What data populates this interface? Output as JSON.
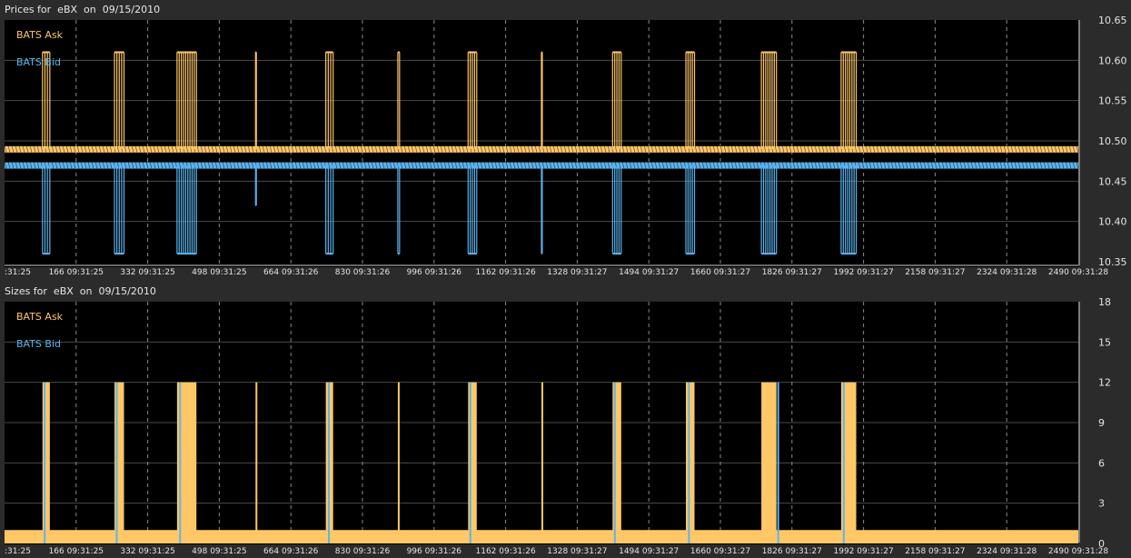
{
  "chart_data": [
    {
      "type": "line",
      "title": "Prices for  eBX  on  09/15/2010",
      "legend": "top-left",
      "grid": true,
      "ylim": [
        10.35,
        10.65
      ],
      "y_ticks": [
        "10.35",
        "10.40",
        "10.45",
        "10.50",
        "10.55",
        "10.60",
        "10.65"
      ],
      "x_range": [
        0,
        2490
      ],
      "x_ticks": [
        {
          "x": 0,
          "label": ":31:25"
        },
        {
          "x": 166,
          "label": "166 09:31:25"
        },
        {
          "x": 332,
          "label": "332 09:31:25"
        },
        {
          "x": 498,
          "label": "498 09:31:25"
        },
        {
          "x": 664,
          "label": "664 09:31:26"
        },
        {
          "x": 830,
          "label": "830 09:31:26"
        },
        {
          "x": 996,
          "label": "996 09:31:26"
        },
        {
          "x": 1162,
          "label": "1162 09:31:26"
        },
        {
          "x": 1328,
          "label": "1328 09:31:27"
        },
        {
          "x": 1494,
          "label": "1494 09:31:27"
        },
        {
          "x": 1660,
          "label": "1660 09:31:27"
        },
        {
          "x": 1826,
          "label": "1826 09:31:27"
        },
        {
          "x": 1992,
          "label": "1992 09:31:27"
        },
        {
          "x": 2158,
          "label": "2158 09:31:27"
        },
        {
          "x": 2324,
          "label": "2324 09:31:28"
        },
        {
          "x": 2490,
          "label": "2490 09:31:28"
        }
      ],
      "series": [
        {
          "name": "BATS Ask",
          "color": "#ffc766",
          "baseline": 10.49,
          "spikes": [
            {
              "x0": 88,
              "x1": 105,
              "y": 10.61
            },
            {
              "x0": 255,
              "x1": 277,
              "y": 10.61
            },
            {
              "x0": 400,
              "x1": 445,
              "y": 10.61
            },
            {
              "x0": 582,
              "x1": 584,
              "y": 10.61
            },
            {
              "x0": 745,
              "x1": 762,
              "y": 10.61
            },
            {
              "x0": 912,
              "x1": 916,
              "y": 10.61
            },
            {
              "x0": 1075,
              "x1": 1095,
              "y": 10.61
            },
            {
              "x0": 1245,
              "x1": 1247,
              "y": 10.61
            },
            {
              "x0": 1410,
              "x1": 1430,
              "y": 10.61
            },
            {
              "x0": 1580,
              "x1": 1600,
              "y": 10.61
            },
            {
              "x0": 1755,
              "x1": 1790,
              "y": 10.61
            },
            {
              "x0": 1940,
              "x1": 1975,
              "y": 10.61
            }
          ]
        },
        {
          "name": "BATS Bid",
          "color": "#5ab4f0",
          "baseline": 10.47,
          "spikes": [
            {
              "x0": 88,
              "x1": 105,
              "y": 10.36
            },
            {
              "x0": 255,
              "x1": 277,
              "y": 10.36
            },
            {
              "x0": 400,
              "x1": 445,
              "y": 10.36
            },
            {
              "x0": 582,
              "x1": 584,
              "y": 10.42
            },
            {
              "x0": 745,
              "x1": 762,
              "y": 10.36
            },
            {
              "x0": 912,
              "x1": 916,
              "y": 10.36
            },
            {
              "x0": 1075,
              "x1": 1095,
              "y": 10.36
            },
            {
              "x0": 1245,
              "x1": 1247,
              "y": 10.36
            },
            {
              "x0": 1410,
              "x1": 1430,
              "y": 10.36
            },
            {
              "x0": 1580,
              "x1": 1600,
              "y": 10.36
            },
            {
              "x0": 1755,
              "x1": 1790,
              "y": 10.36
            },
            {
              "x0": 1940,
              "x1": 1975,
              "y": 10.36
            }
          ]
        }
      ]
    },
    {
      "type": "bar",
      "title": "Sizes for  eBX  on  09/15/2010",
      "legend": "top-left",
      "grid": true,
      "ylim": [
        0,
        18
      ],
      "y_ticks": [
        "0",
        "3",
        "6",
        "9",
        "12",
        "15",
        "18"
      ],
      "x_range": [
        0,
        2490
      ],
      "x_ticks": [
        {
          "x": 0,
          "label": ":31:25"
        },
        {
          "x": 166,
          "label": "166 09:31:25"
        },
        {
          "x": 332,
          "label": "332 09:31:25"
        },
        {
          "x": 498,
          "label": "498 09:31:25"
        },
        {
          "x": 664,
          "label": "664 09:31:26"
        },
        {
          "x": 830,
          "label": "830 09:31:26"
        },
        {
          "x": 996,
          "label": "996 09:31:26"
        },
        {
          "x": 1162,
          "label": "1162 09:31:26"
        },
        {
          "x": 1328,
          "label": "1328 09:31:27"
        },
        {
          "x": 1494,
          "label": "1494 09:31:27"
        },
        {
          "x": 1660,
          "label": "1660 09:31:27"
        },
        {
          "x": 1826,
          "label": "1826 09:31:27"
        },
        {
          "x": 1992,
          "label": "1992 09:31:27"
        },
        {
          "x": 2158,
          "label": "2158 09:31:27"
        },
        {
          "x": 2324,
          "label": "2324 09:31:28"
        },
        {
          "x": 2490,
          "label": "2490 09:31:28"
        }
      ],
      "series": [
        {
          "name": "BATS Ask",
          "color": "#ffc766",
          "baseline": 1,
          "spikes": [
            {
              "x0": 88,
              "x1": 105,
              "y": 12
            },
            {
              "x0": 255,
              "x1": 277,
              "y": 12
            },
            {
              "x0": 400,
              "x1": 445,
              "y": 12
            },
            {
              "x0": 582,
              "x1": 584,
              "y": 12
            },
            {
              "x0": 745,
              "x1": 762,
              "y": 12
            },
            {
              "x0": 912,
              "x1": 916,
              "y": 12
            },
            {
              "x0": 1075,
              "x1": 1095,
              "y": 12
            },
            {
              "x0": 1245,
              "x1": 1247,
              "y": 12
            },
            {
              "x0": 1410,
              "x1": 1430,
              "y": 12
            },
            {
              "x0": 1580,
              "x1": 1600,
              "y": 12
            },
            {
              "x0": 1755,
              "x1": 1790,
              "y": 12
            },
            {
              "x0": 1940,
              "x1": 1975,
              "y": 12
            }
          ]
        },
        {
          "name": "BATS Bid",
          "color": "#5ab4f0",
          "baseline": 1,
          "spikes": [
            {
              "x0": 91,
              "x1": 93,
              "y": 12
            },
            {
              "x0": 258,
              "x1": 260,
              "y": 12
            },
            {
              "x0": 405,
              "x1": 408,
              "y": 12
            },
            {
              "x0": 750,
              "x1": 752,
              "y": 12
            },
            {
              "x0": 1078,
              "x1": 1080,
              "y": 12
            },
            {
              "x0": 1413,
              "x1": 1415,
              "y": 12
            },
            {
              "x0": 1585,
              "x1": 1587,
              "y": 12
            },
            {
              "x0": 1792,
              "x1": 1794,
              "y": 12
            },
            {
              "x0": 1944,
              "x1": 1946,
              "y": 12
            }
          ]
        }
      ]
    }
  ]
}
